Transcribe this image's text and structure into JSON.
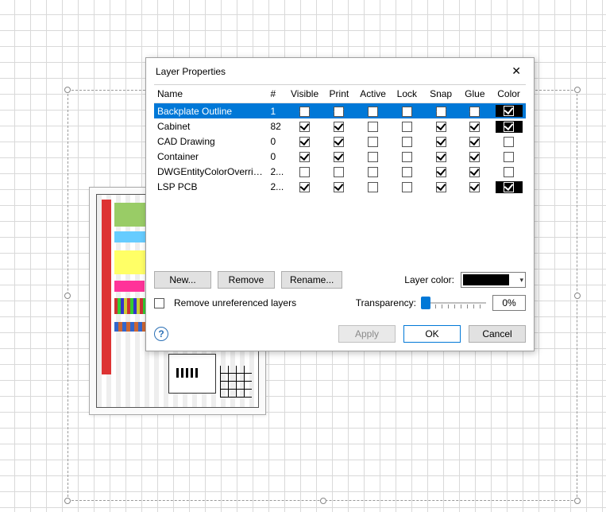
{
  "dialog": {
    "title": "Layer Properties",
    "columns": [
      "Name",
      "#",
      "Visible",
      "Print",
      "Active",
      "Lock",
      "Snap",
      "Glue",
      "Color"
    ],
    "rows": [
      {
        "name": "Backplate Outline",
        "count": "1",
        "visible": true,
        "print": true,
        "active": false,
        "lock": false,
        "snap": true,
        "glue": true,
        "color": "black",
        "selected": true
      },
      {
        "name": "Cabinet",
        "count": "82",
        "visible": true,
        "print": true,
        "active": false,
        "lock": false,
        "snap": true,
        "glue": true,
        "color": "black"
      },
      {
        "name": "CAD Drawing",
        "count": "0",
        "visible": true,
        "print": true,
        "active": false,
        "lock": false,
        "snap": true,
        "glue": true,
        "color": "none"
      },
      {
        "name": "Container",
        "count": "0",
        "visible": true,
        "print": true,
        "active": false,
        "lock": false,
        "snap": true,
        "glue": true,
        "color": "none"
      },
      {
        "name": "DWGEntityColorOverrideL...",
        "count": "2...",
        "visible": false,
        "print": false,
        "active": false,
        "lock": false,
        "snap": true,
        "glue": true,
        "color": "none"
      },
      {
        "name": "LSP PCB",
        "count": "2...",
        "visible": true,
        "print": true,
        "active": false,
        "lock": false,
        "snap": true,
        "glue": true,
        "color": "black"
      }
    ],
    "buttons": {
      "new": "New...",
      "remove": "Remove",
      "rename": "Rename..."
    },
    "layer_color_label": "Layer color:",
    "layer_color_value": "#000000",
    "remove_unref_label": "Remove unreferenced layers",
    "remove_unref_checked": false,
    "transparency_label": "Transparency:",
    "transparency_value": "0%",
    "footer": {
      "apply": "Apply",
      "ok": "OK",
      "cancel": "Cancel"
    }
  }
}
